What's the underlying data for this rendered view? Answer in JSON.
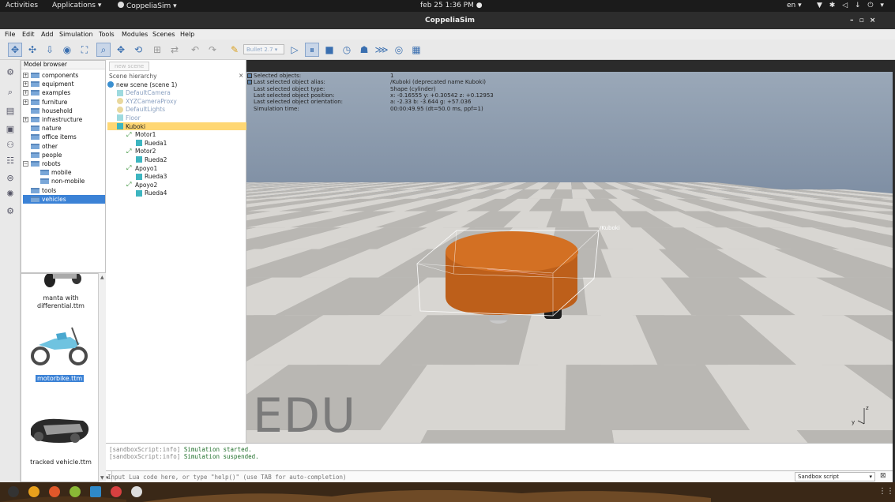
{
  "topbar": {
    "activities": "Activities",
    "applications": "Applications ▾",
    "app": "CoppeliaSim ▾",
    "clock": "feb 25  1:36 PM  ●",
    "lang": "en ▾",
    "tray": "▼ ✱ ◁ ↓ ⏻ ▾"
  },
  "window": {
    "title": "CoppeliaSim",
    "controls": "–  ▫  ×"
  },
  "menu": [
    "File",
    "Edit",
    "Add",
    "Simulation",
    "Tools",
    "Modules",
    "Scenes",
    "Help"
  ],
  "toolbar": {
    "engine": "Bullet 2.7 ▾",
    "icons": [
      "move-icon",
      "move-icon",
      "move-down-icon",
      "camera-icon",
      "fit-icon",
      "select-icon",
      "move-object-icon",
      "rotate-object-icon",
      "assembly-icon",
      "transfer-dna-icon",
      "undo-icon",
      "redo-icon",
      "engine-settings-icon",
      "play-icon",
      "pause-icon",
      "stop-icon",
      "realtime-icon",
      "visualization-icon",
      "thread-icon",
      "eye-icon",
      "layers-icon"
    ]
  },
  "model_browser": {
    "header": "Model browser",
    "items": [
      {
        "label": "components",
        "expand": "+",
        "indent": 0
      },
      {
        "label": "equipment",
        "expand": "+",
        "indent": 0
      },
      {
        "label": "examples",
        "expand": "+",
        "indent": 0
      },
      {
        "label": "furniture",
        "expand": "+",
        "indent": 0
      },
      {
        "label": "household",
        "expand": "",
        "indent": 0
      },
      {
        "label": "infrastructure",
        "expand": "+",
        "indent": 0
      },
      {
        "label": "nature",
        "expand": "",
        "indent": 0
      },
      {
        "label": "office items",
        "expand": "",
        "indent": 0
      },
      {
        "label": "other",
        "expand": "",
        "indent": 0
      },
      {
        "label": "people",
        "expand": "",
        "indent": 0
      },
      {
        "label": "robots",
        "expand": "−",
        "indent": 0
      },
      {
        "label": "mobile",
        "expand": "",
        "indent": 1
      },
      {
        "label": "non-mobile",
        "expand": "",
        "indent": 1
      },
      {
        "label": "tools",
        "expand": "",
        "indent": 0
      },
      {
        "label": "vehicles",
        "expand": "",
        "indent": 0,
        "selected": true
      }
    ]
  },
  "thumbnails": [
    {
      "label1": "manta with",
      "label2": "differential.ttm"
    },
    {
      "label1": "motorbike.ttm",
      "label2": ""
    },
    {
      "label1": "tracked vehicle.ttm",
      "label2": ""
    }
  ],
  "scene_tab": "new scene",
  "scene_hierarchy": {
    "header": "Scene hierarchy",
    "close": "×",
    "items": [
      {
        "label": "new scene (scene 1)",
        "indent": 0,
        "type": "scene"
      },
      {
        "label": "DefaultCamera",
        "indent": 1,
        "type": "camera",
        "faded": true
      },
      {
        "label": "XYZCameraProxy",
        "indent": 1,
        "type": "dummy",
        "faded": true
      },
      {
        "label": "DefaultLights",
        "indent": 1,
        "type": "dummy",
        "faded": true
      },
      {
        "label": "Floor",
        "indent": 1,
        "type": "shape",
        "faded": true
      },
      {
        "label": "Kuboki",
        "indent": 1,
        "type": "shape",
        "selected": true
      },
      {
        "label": "Motor1",
        "indent": 2,
        "type": "joint"
      },
      {
        "label": "Rueda1",
        "indent": 3,
        "type": "shape"
      },
      {
        "label": "Motor2",
        "indent": 2,
        "type": "joint"
      },
      {
        "label": "Rueda2",
        "indent": 3,
        "type": "shape"
      },
      {
        "label": "Apoyo1",
        "indent": 2,
        "type": "joint"
      },
      {
        "label": "Rueda3",
        "indent": 3,
        "type": "shape"
      },
      {
        "label": "Apoyo2",
        "indent": 2,
        "type": "joint"
      },
      {
        "label": "Rueda4",
        "indent": 3,
        "type": "shape"
      }
    ]
  },
  "info": {
    "rows": [
      {
        "k": "Selected objects:",
        "v": "1"
      },
      {
        "k": "Last selected object alias:",
        "v": "/Kuboki     (deprecated name Kuboki)"
      },
      {
        "k": "Last selected object type:",
        "v": "Shape (cylinder)"
      },
      {
        "k": "Last selected object position:",
        "v": "x: -0.16555   y: +0.30542   z: +0.12953"
      },
      {
        "k": "Last selected object orientation:",
        "v": "a: -2.33    b: -3.644    g: +57.036"
      },
      {
        "k": "Simulation time:",
        "v": "00:00:49.95 (dt=50.0 ms, ppf=1)"
      }
    ]
  },
  "viewport": {
    "object_label": "/Kuboki",
    "watermark": "EDU",
    "axis_z": "z",
    "axis_y": "y",
    "colors": {
      "sky": "#8f9fb3",
      "floor_light": "#d8d6d2",
      "floor_dark": "#b9b7b3",
      "body": "#c7641c"
    }
  },
  "console": {
    "lines": [
      {
        "tag": "[sandboxScript:info]",
        "msg": "Simulation started."
      },
      {
        "tag": "[sandboxScript:info]",
        "msg": "Simulation suspended."
      }
    ]
  },
  "command": {
    "placeholder": "Input Lua code here, or type \"help()\" (use TAB for auto-completion)",
    "script_select": "Sandbox script",
    "select_arrow": "▾",
    "clear": "⊠"
  }
}
